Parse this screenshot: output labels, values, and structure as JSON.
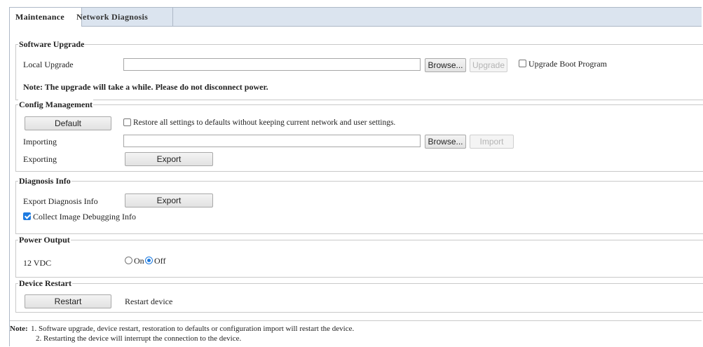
{
  "tabs": [
    "Maintenance",
    "Network Diagnosis"
  ],
  "software_upgrade": {
    "title": "Software Upgrade",
    "local_upgrade_label": "Local Upgrade",
    "browse": "Browse...",
    "upgrade": "Upgrade",
    "boot_program_label": "Upgrade Boot Program",
    "boot_program_checked": false,
    "note": "Note: The upgrade will take a while. Please do not disconnect power."
  },
  "config_management": {
    "title": "Config Management",
    "default_button": "Default",
    "restore_label": "Restore all settings to defaults without keeping current network and user settings.",
    "restore_checked": false,
    "importing_label": "Importing",
    "browse": "Browse...",
    "import": "Import",
    "exporting_label": "Exporting",
    "export": "Export"
  },
  "diagnosis_info": {
    "title": "Diagnosis Info",
    "export_label": "Export Diagnosis Info",
    "export": "Export",
    "collect_label": "Collect Image Debugging Info",
    "collect_checked": true
  },
  "power_output": {
    "title": "Power Output",
    "label": "12 VDC",
    "on": "On",
    "off": "Off",
    "selected": "Off"
  },
  "device_restart": {
    "title": "Device Restart",
    "button": "Restart",
    "label": "Restart device"
  },
  "footer": {
    "note_label": "Note:",
    "line1": "1. Software upgrade, device restart, restoration to defaults or configuration import will restart the device.",
    "line2": "2. Restarting the device will interrupt the connection to the device."
  },
  "colors": {
    "accent": "#1e7be0",
    "tabbar": "#dbe4ef"
  }
}
